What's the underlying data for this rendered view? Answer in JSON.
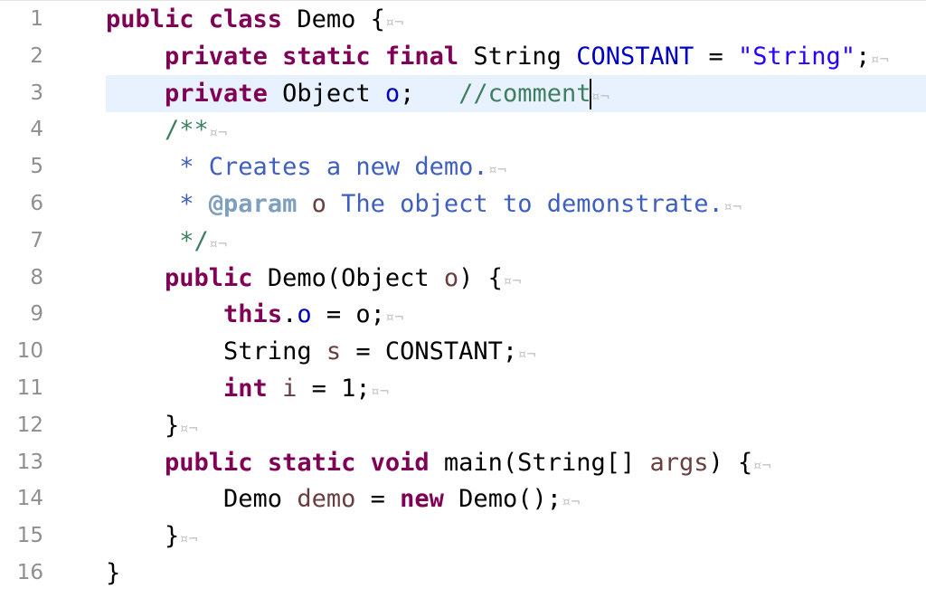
{
  "editor": {
    "current_line": 3,
    "colors": {
      "keyword": "#7f0055",
      "field": "#0000c0",
      "string": "#2a00ff",
      "comment": "#3f7f5f",
      "javadoc": "#3f5fbf",
      "javadoc_tag": "#7f9fbf",
      "local_variable": "#6a3e3e",
      "current_line_highlight": "#e8f2fe"
    },
    "lines": [
      {
        "num": "1",
        "tokens": [
          {
            "t": "kw",
            "v": "public class"
          },
          {
            "t": "plain",
            "v": " Demo {"
          },
          {
            "t": "ws",
            "v": "¤¬"
          }
        ]
      },
      {
        "num": "2",
        "tokens": [
          {
            "t": "plain",
            "v": "    "
          },
          {
            "t": "kw",
            "v": "private static final"
          },
          {
            "t": "plain",
            "v": " String "
          },
          {
            "t": "field",
            "v": "CONSTANT"
          },
          {
            "t": "plain",
            "v": " = "
          },
          {
            "t": "str",
            "v": "\"String\""
          },
          {
            "t": "plain",
            "v": ";"
          },
          {
            "t": "ws",
            "v": "¤¬"
          }
        ]
      },
      {
        "num": "3",
        "tokens": [
          {
            "t": "plain",
            "v": "    "
          },
          {
            "t": "kw",
            "v": "private"
          },
          {
            "t": "plain",
            "v": " Object "
          },
          {
            "t": "field",
            "v": "o"
          },
          {
            "t": "plain",
            "v": ";   "
          },
          {
            "t": "comment",
            "v": "//comment"
          },
          {
            "t": "caret",
            "v": ""
          },
          {
            "t": "ws",
            "v": "¤¬"
          }
        ]
      },
      {
        "num": "4",
        "tokens": [
          {
            "t": "plain",
            "v": "    "
          },
          {
            "t": "comment",
            "v": "/**"
          },
          {
            "t": "ws",
            "v": "¤¬"
          }
        ]
      },
      {
        "num": "5",
        "tokens": [
          {
            "t": "plain",
            "v": "     "
          },
          {
            "t": "doc",
            "v": "* Creates a new demo."
          },
          {
            "t": "ws",
            "v": "¤¬"
          }
        ]
      },
      {
        "num": "6",
        "tokens": [
          {
            "t": "plain",
            "v": "     "
          },
          {
            "t": "doc",
            "v": "* "
          },
          {
            "t": "doctag",
            "v": "@param"
          },
          {
            "t": "plain",
            "v": " "
          },
          {
            "t": "local",
            "v": "o"
          },
          {
            "t": "doc",
            "v": " The object to demonstrate."
          },
          {
            "t": "ws",
            "v": "¤¬"
          }
        ]
      },
      {
        "num": "7",
        "tokens": [
          {
            "t": "plain",
            "v": "     "
          },
          {
            "t": "comment",
            "v": "*/"
          },
          {
            "t": "ws",
            "v": "¤¬"
          }
        ]
      },
      {
        "num": "8",
        "tokens": [
          {
            "t": "plain",
            "v": "    "
          },
          {
            "t": "kw",
            "v": "public"
          },
          {
            "t": "plain",
            "v": " Demo(Object "
          },
          {
            "t": "local",
            "v": "o"
          },
          {
            "t": "plain",
            "v": ") {"
          },
          {
            "t": "ws",
            "v": "¤¬"
          }
        ]
      },
      {
        "num": "9",
        "tokens": [
          {
            "t": "plain",
            "v": "        "
          },
          {
            "t": "kw",
            "v": "this"
          },
          {
            "t": "plain",
            "v": "."
          },
          {
            "t": "field",
            "v": "o"
          },
          {
            "t": "plain",
            "v": " = o;"
          },
          {
            "t": "ws",
            "v": "¤¬"
          }
        ]
      },
      {
        "num": "10",
        "tokens": [
          {
            "t": "plain",
            "v": "        String "
          },
          {
            "t": "local",
            "v": "s"
          },
          {
            "t": "plain",
            "v": " = CONSTANT;"
          },
          {
            "t": "ws",
            "v": "¤¬"
          }
        ]
      },
      {
        "num": "11",
        "tokens": [
          {
            "t": "plain",
            "v": "        "
          },
          {
            "t": "kw",
            "v": "int"
          },
          {
            "t": "plain",
            "v": " "
          },
          {
            "t": "local",
            "v": "i"
          },
          {
            "t": "plain",
            "v": " = 1;"
          },
          {
            "t": "ws",
            "v": "¤¬"
          }
        ]
      },
      {
        "num": "12",
        "tokens": [
          {
            "t": "plain",
            "v": "    }"
          },
          {
            "t": "ws",
            "v": "¤¬"
          }
        ]
      },
      {
        "num": "13",
        "tokens": [
          {
            "t": "plain",
            "v": "    "
          },
          {
            "t": "kw",
            "v": "public static void"
          },
          {
            "t": "plain",
            "v": " main(String[] "
          },
          {
            "t": "local",
            "v": "args"
          },
          {
            "t": "plain",
            "v": ") {"
          },
          {
            "t": "ws",
            "v": "¤¬"
          }
        ]
      },
      {
        "num": "14",
        "tokens": [
          {
            "t": "plain",
            "v": "        Demo "
          },
          {
            "t": "local",
            "v": "demo"
          },
          {
            "t": "plain",
            "v": " = "
          },
          {
            "t": "kw",
            "v": "new"
          },
          {
            "t": "plain",
            "v": " Demo();"
          },
          {
            "t": "ws",
            "v": "¤¬"
          }
        ]
      },
      {
        "num": "15",
        "tokens": [
          {
            "t": "plain",
            "v": "    }"
          },
          {
            "t": "ws",
            "v": "¤¬"
          }
        ]
      },
      {
        "num": "16",
        "tokens": [
          {
            "t": "plain",
            "v": "}"
          }
        ]
      }
    ]
  }
}
